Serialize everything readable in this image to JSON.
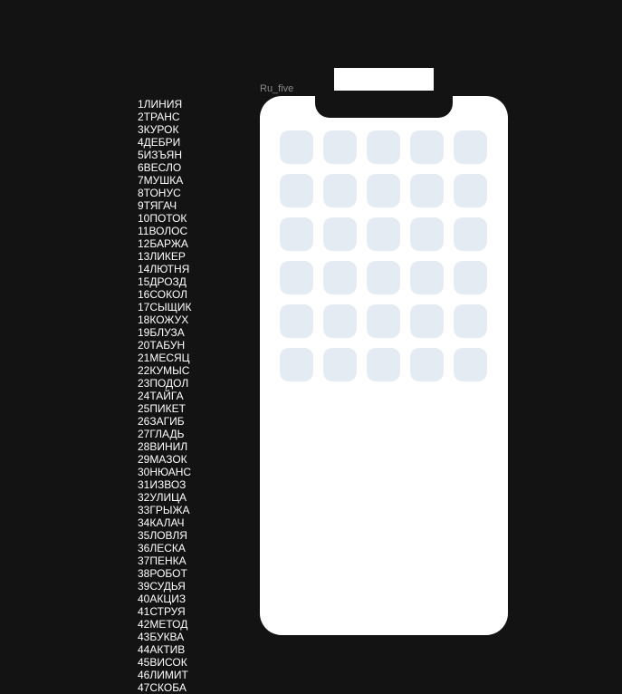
{
  "frame_label": "Ru_five",
  "words": [
    "1ЛИНИЯ",
    "2ТРАНС",
    "3КУРОК",
    "4ДЕБРИ",
    "5ИЗЪЯН",
    "6ВЕСЛО",
    "7МУШКА",
    "8ТОНУС",
    "9ТЯГАЧ",
    "10ПОТОК",
    "11ВОЛОС",
    "12БАРЖА",
    "13ЛИКЕР",
    "14ЛЮТНЯ",
    "15ДРОЗД",
    "16СОКОЛ",
    "17СЫЩИК",
    "18КОЖУХ",
    "19БЛУЗА",
    "20ТАБУН",
    "21МЕСЯЦ",
    "22КУМЫС",
    "23ПОДОЛ",
    "24ТАЙГА",
    "25ПИКЕТ",
    "26ЗАГИБ",
    "27ГЛАДЬ",
    "28ВИНИЛ",
    "29МАЗОК",
    "30НЮАНС",
    "31ИЗВОЗ",
    "32УЛИЦА",
    "33ГРЫЖА",
    "34КАЛАЧ",
    "35ЛОВЛЯ",
    "36ЛЕСКА",
    "37ПЕНКА",
    "38РОБОТ",
    "39СУДЬЯ",
    "40АКЦИЗ",
    "41СТРУЯ",
    "42МЕТОД",
    "43БУКВА",
    "44АКТИВ",
    "45ВИСОК",
    "46ЛИМИТ",
    "47СКОБА"
  ],
  "grid": {
    "rows": 6,
    "cols": 5,
    "cell_color": "#e4ebf3"
  },
  "colors": {
    "background": "#131313",
    "phone": "#ffffff",
    "label": "#8a8a8a",
    "text": "#ffffff"
  }
}
